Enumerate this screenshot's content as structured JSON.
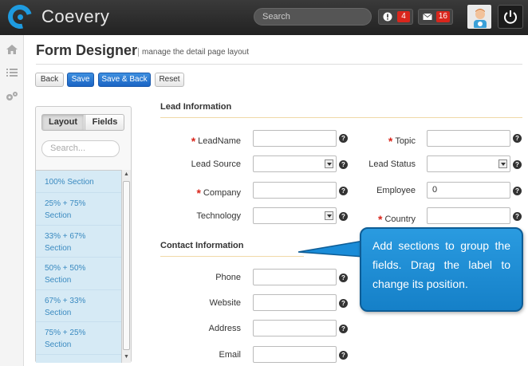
{
  "app": {
    "brand": "Coevery"
  },
  "topbar": {
    "search_placeholder": "Search",
    "alerts_count": "4",
    "messages_count": "16"
  },
  "page": {
    "title": "Form Designer",
    "subtitle": "manage the detail page layout"
  },
  "toolbar": {
    "back": "Back",
    "save": "Save",
    "save_back": "Save & Back",
    "reset": "Reset"
  },
  "panel": {
    "tabs": [
      "Layout",
      "Fields"
    ],
    "active_tab": "Layout",
    "search_placeholder": "Search...",
    "sections": [
      [
        "100% Section",
        ""
      ],
      [
        "25% + 75%",
        "Section"
      ],
      [
        "33% + 67%",
        "Section"
      ],
      [
        "50% + 50%",
        "Section"
      ],
      [
        "67% + 33%",
        "Section"
      ],
      [
        "75% + 25%",
        "Section"
      ]
    ]
  },
  "lead": {
    "title": "Lead Information",
    "fields": {
      "leadname": {
        "label": "LeadName",
        "required": true,
        "value": ""
      },
      "topic": {
        "label": "Topic",
        "required": true,
        "value": ""
      },
      "lead_source": {
        "label": "Lead Source",
        "required": false,
        "value": ""
      },
      "lead_status": {
        "label": "Lead Status",
        "required": false,
        "value": ""
      },
      "company": {
        "label": "Company",
        "required": true,
        "value": ""
      },
      "employee": {
        "label": "Employee",
        "required": false,
        "value": "0"
      },
      "technology": {
        "label": "Technology",
        "required": false,
        "value": ""
      },
      "country": {
        "label": "Country",
        "required": true,
        "value": ""
      }
    }
  },
  "contact": {
    "title": "Contact Information",
    "fields": {
      "phone": {
        "label": "Phone",
        "value": ""
      },
      "website": {
        "label": "Website",
        "value": ""
      },
      "address": {
        "label": "Address",
        "value": ""
      },
      "email": {
        "label": "Email",
        "value": ""
      }
    }
  },
  "callout": {
    "text": "Add sections to group the fields. Drag the label to change its position."
  },
  "required_mark": "*",
  "help_mark": "?",
  "colors": {
    "accent": "#1e9be0",
    "primary_button": "#1a64c4",
    "required": "#d9261c",
    "callout": "#1a8cd8"
  }
}
